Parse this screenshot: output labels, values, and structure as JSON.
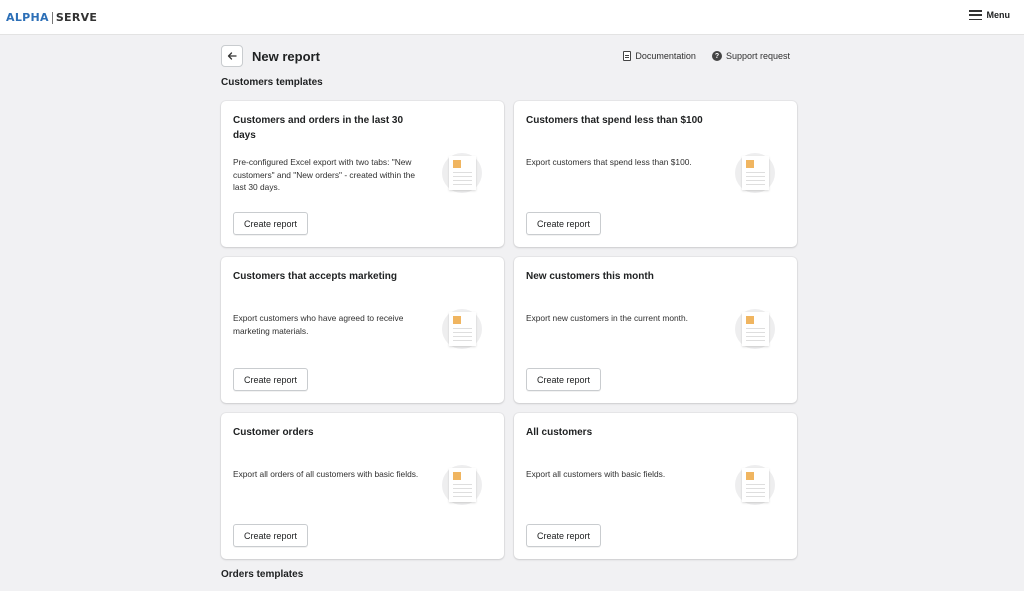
{
  "brand": {
    "part1": "ALPHA",
    "part2": "SERVE"
  },
  "topbar": {
    "menu_label": "Menu"
  },
  "header": {
    "title": "New report",
    "documentation_label": "Documentation",
    "support_label": "Support request"
  },
  "sections": {
    "customers_title": "Customers templates",
    "orders_title": "Orders templates"
  },
  "cards": [
    {
      "title": "Customers and orders in the last 30 days",
      "description": "Pre-configured Excel export with two tabs: \"New customers\" and \"New orders\" - created within the last 30 days.",
      "button": "Create report"
    },
    {
      "title": "Customers that spend less than $100",
      "description": "Export customers that spend less than $100.",
      "button": "Create report"
    },
    {
      "title": "Customers that accepts marketing",
      "description": "Export customers who have agreed to receive marketing materials.",
      "button": "Create report"
    },
    {
      "title": "New customers this month",
      "description": "Export new customers in the current month.",
      "button": "Create report"
    },
    {
      "title": "Customer orders",
      "description": "Export all orders of all customers with basic fields.",
      "button": "Create report"
    },
    {
      "title": "All customers",
      "description": "Export all customers with basic fields.",
      "button": "Create report"
    }
  ],
  "icons": {
    "back": "arrow-left-icon",
    "documentation": "document-icon",
    "support": "question-circle-icon",
    "menu": "hamburger-icon",
    "card_thumb": "report-document-icon"
  },
  "colors": {
    "brand_blue": "#2c6fb7",
    "thumb_accent": "#f0b560",
    "page_bg": "#f1f1f3"
  }
}
